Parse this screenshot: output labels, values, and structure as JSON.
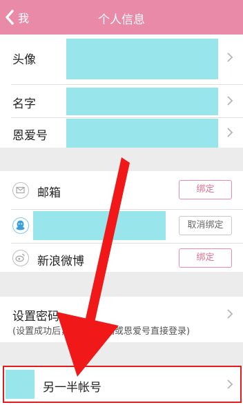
{
  "header": {
    "back_label": "我",
    "title": "个人信息"
  },
  "profile": {
    "avatar_label": "头像",
    "name_label": "名字",
    "enai_label": "恩爱号"
  },
  "bindings": {
    "email": {
      "label": "邮箱",
      "button": "绑定"
    },
    "qq": {
      "button": "取消绑定"
    },
    "weibo": {
      "label": "新浪微博",
      "button": "绑定"
    }
  },
  "password": {
    "label": "设置密码",
    "note_left": "(设置成功后，",
    "note_right": "箱或恩爱号直接登录)"
  },
  "partner": {
    "label": "另一半帐号"
  },
  "colors": {
    "header": "#e98aa8",
    "placeholder": "#98e5ec",
    "highlight": "#e21b1b",
    "arrow": "#f01818"
  },
  "icons": [
    "chevron-left-icon",
    "chevron-right-icon",
    "mail-icon",
    "qq-icon",
    "weibo-icon"
  ]
}
